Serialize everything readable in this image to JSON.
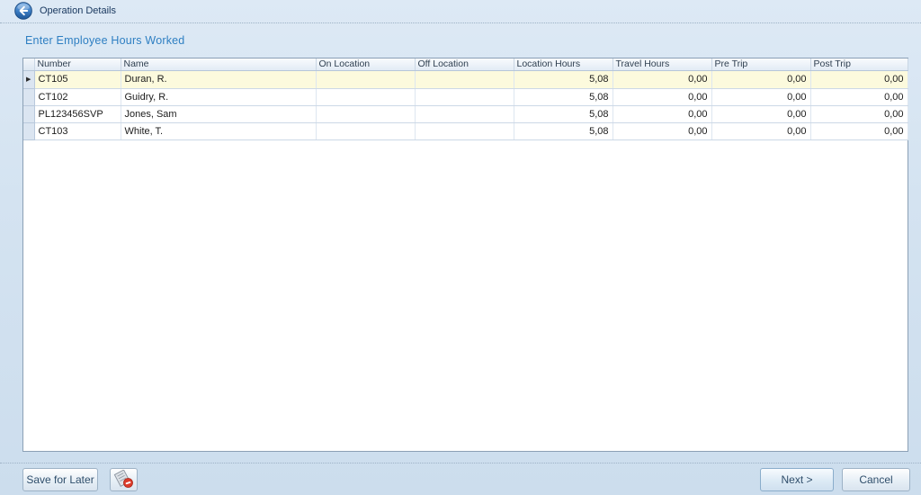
{
  "header": {
    "title": "Operation Details"
  },
  "page": {
    "heading": "Enter Employee Hours Worked"
  },
  "grid": {
    "columns": [
      "Number",
      "Name",
      "On Location",
      "Off Location",
      "Location Hours",
      "Travel Hours",
      "Pre Trip",
      "Post Trip"
    ],
    "row_marker": "▶",
    "rows": [
      {
        "number": "CT105",
        "name": "Duran, R.",
        "on_location": "",
        "off_location": "",
        "location_hours": "5,08",
        "travel_hours": "0,00",
        "pre_trip": "0,00",
        "post_trip": "0,00",
        "selected": true
      },
      {
        "number": "CT102",
        "name": "Guidry, R.",
        "on_location": "",
        "off_location": "",
        "location_hours": "5,08",
        "travel_hours": "0,00",
        "pre_trip": "0,00",
        "post_trip": "0,00",
        "selected": false
      },
      {
        "number": "PL123456SVP",
        "name": "Jones, Sam",
        "on_location": "",
        "off_location": "",
        "location_hours": "5,08",
        "travel_hours": "0,00",
        "pre_trip": "0,00",
        "post_trip": "0,00",
        "selected": false
      },
      {
        "number": "CT103",
        "name": "White, T.",
        "on_location": "",
        "off_location": "",
        "location_hours": "5,08",
        "travel_hours": "0,00",
        "pre_trip": "0,00",
        "post_trip": "0,00",
        "selected": false
      }
    ]
  },
  "footer": {
    "save_for_later_label": "Save for Later",
    "next_label": "Next >",
    "cancel_label": "Cancel"
  },
  "icons": {
    "back": "back-arrow-icon",
    "notes_blocked": "notes-blocked-icon"
  },
  "colors": {
    "selected_row": "#fcfadd",
    "heading_text": "#2e7fc2",
    "title_text": "#17365d",
    "danger_badge": "#dd3b2a",
    "background": "#d4e3f1"
  }
}
